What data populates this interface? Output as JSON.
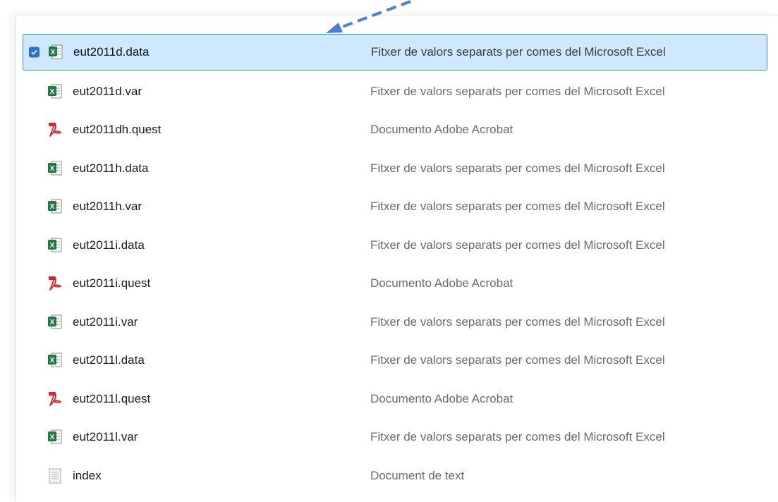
{
  "files": [
    {
      "name": "eut2011d.data",
      "type": "Fitxer de valors separats per comes del Microsoft Excel",
      "icon": "excel-csv-icon",
      "selected": true
    },
    {
      "name": "eut2011d.var",
      "type": "Fitxer de valors separats per comes del Microsoft Excel",
      "icon": "excel-csv-icon",
      "selected": false
    },
    {
      "name": "eut2011dh.quest",
      "type": "Documento Adobe Acrobat",
      "icon": "pdf-icon",
      "selected": false
    },
    {
      "name": "eut2011h.data",
      "type": "Fitxer de valors separats per comes del Microsoft Excel",
      "icon": "excel-csv-icon",
      "selected": false
    },
    {
      "name": "eut2011h.var",
      "type": "Fitxer de valors separats per comes del Microsoft Excel",
      "icon": "excel-csv-icon",
      "selected": false
    },
    {
      "name": "eut2011i.data",
      "type": "Fitxer de valors separats per comes del Microsoft Excel",
      "icon": "excel-csv-icon",
      "selected": false
    },
    {
      "name": "eut2011i.quest",
      "type": "Documento Adobe Acrobat",
      "icon": "pdf-icon",
      "selected": false
    },
    {
      "name": "eut2011i.var",
      "type": "Fitxer de valors separats per comes del Microsoft Excel",
      "icon": "excel-csv-icon",
      "selected": false
    },
    {
      "name": "eut2011l.data",
      "type": "Fitxer de valors separats per comes del Microsoft Excel",
      "icon": "excel-csv-icon",
      "selected": false
    },
    {
      "name": "eut2011l.quest",
      "type": "Documento Adobe Acrobat",
      "icon": "pdf-icon",
      "selected": false
    },
    {
      "name": "eut2011l.var",
      "type": "Fitxer de valors separats per comes del Microsoft Excel",
      "icon": "excel-csv-icon",
      "selected": false
    },
    {
      "name": "index",
      "type": "Document de text",
      "icon": "text-file-icon",
      "selected": false
    }
  ],
  "colors": {
    "selection_bg": "#cde8ff",
    "selection_border": "#3f8ad9",
    "checkbox": "#2b6fcf",
    "arrow": "#4a7fd6",
    "excel_green": "#1f7a45",
    "pdf_red": "#d12b2b"
  }
}
